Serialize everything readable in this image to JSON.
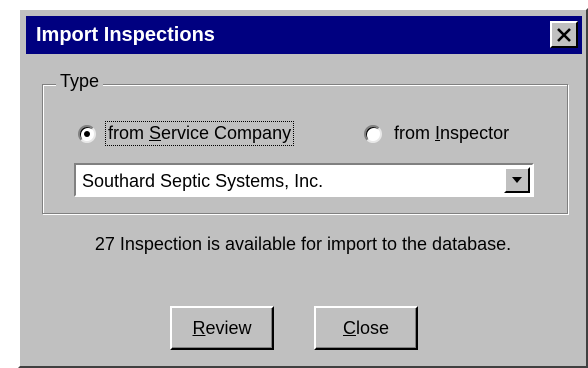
{
  "dialog": {
    "title": "Import Inspections",
    "close_icon": "close-x-icon"
  },
  "type_group": {
    "legend": "Type",
    "options": [
      {
        "prefix": "from ",
        "accel": "S",
        "rest": "ervice Company",
        "selected": true
      },
      {
        "prefix": "from ",
        "accel": "I",
        "rest": "nspector",
        "selected": false
      }
    ]
  },
  "company_select": {
    "value": "Southard Septic Systems, Inc.",
    "dropdown_icon": "chevron-down-icon"
  },
  "status": "27 Inspection is available for import to the database.",
  "buttons": {
    "review": {
      "accel": "R",
      "rest": "eview"
    },
    "close": {
      "accel": "C",
      "rest": "lose"
    }
  },
  "colors": {
    "titlebar": "#000080",
    "face": "#c0c0c0"
  }
}
